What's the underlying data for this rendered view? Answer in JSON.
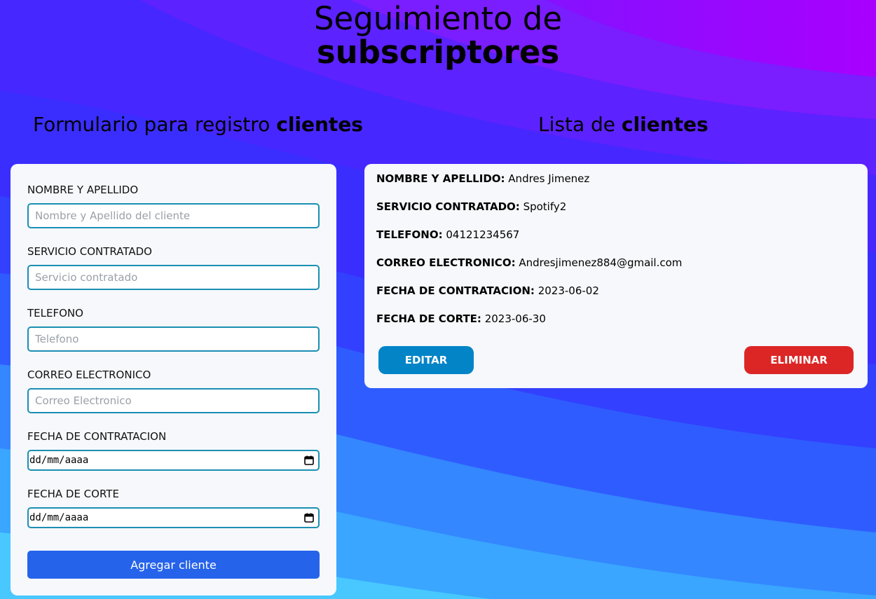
{
  "header": {
    "title_line1": "Seguimiento de",
    "title_line2": "subscriptores"
  },
  "form_section": {
    "heading_normal": "Formulario para registro",
    "heading_bold": "clientes",
    "fields": [
      {
        "label": "NOMBRE Y APELLIDO",
        "placeholder": "Nombre y Apellido del cliente",
        "value": ""
      },
      {
        "label": "SERVICIO CONTRATADO",
        "placeholder": "Servicio contratado",
        "value": ""
      },
      {
        "label": "TELEFONO",
        "placeholder": "Telefono",
        "value": ""
      },
      {
        "label": "CORREO ELECTRONICO",
        "placeholder": "Correo Electronico",
        "value": ""
      },
      {
        "label": "FECHA DE CONTRATACION",
        "date_format": "dd/mm/aaaa",
        "icon": "calendar-icon"
      },
      {
        "label": "FECHA DE CORTE",
        "date_format": "dd/mm/aaaa",
        "icon": "calendar-icon"
      }
    ],
    "submit_label": "Agregar cliente"
  },
  "list_section": {
    "heading_normal": "Lista de",
    "heading_bold": "clientes",
    "clients": [
      {
        "fields": [
          {
            "key": "NOMBRE Y APELLIDO:",
            "value": "Andres Jimenez"
          },
          {
            "key": "SERVICIO CONTRATADO:",
            "value": "Spotify2"
          },
          {
            "key": "TELEFONO:",
            "value": "04121234567"
          },
          {
            "key": "CORREO ELECTRONICO:",
            "value": "Andresjimenez884@gmail.com"
          },
          {
            "key": "FECHA DE CONTRATACION:",
            "value": "2023-06-02"
          },
          {
            "key": "FECHA DE CORTE:",
            "value": "2023-06-30"
          }
        ],
        "edit_label": "EDITAR",
        "delete_label": "ELIMINAR"
      }
    ]
  },
  "colors": {
    "primary_button": "#2563eb",
    "edit_button": "#0284c7",
    "delete_button": "#dc2626",
    "input_border": "#1b8fb3",
    "card_background": "#f6f8fb"
  }
}
